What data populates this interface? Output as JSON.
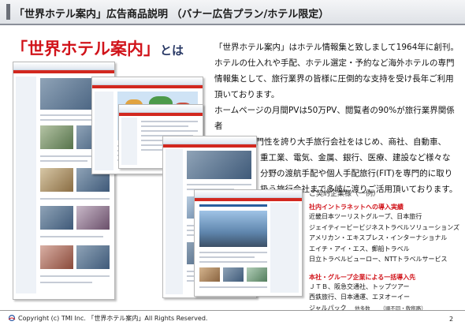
{
  "header": {
    "title": "「世界ホテル案内」広告商品説明 （バナー広告プラン/ホテル限定）"
  },
  "headline": {
    "main": "「世界ホテル案内」",
    "suffix": "とは"
  },
  "intro": {
    "p1": "「世界ホテル案内」はホテル情報集と致しまして1964年に創刊。",
    "p2": "ホテルの仕入れや手配、ホテル選定・予約など海外ホテルの専門",
    "p3": "情報集として、旅行業界の皆様に圧倒的な支持を受け長年ご利用",
    "p4": "頂いております。",
    "p5": "ホームページの月間PVは50万PV、閲覧者の90%が旅行業界関係者",
    "p6": "を占める専門性を誇り大手旅行会社をはじめ、商社、自動車、",
    "p7": "重工業、電気、金属、銀行、医療、建設など様々な",
    "p8": "分野の渡航手配や個人手配旅行(FIT)を専門的に取り",
    "p9": "扱う旅行会社まで多岐に渡りご活用頂いております。"
  },
  "clients": {
    "heading": "ご契約企業様（一例）",
    "intranet_heading": "社内イントラネットへの導入実績",
    "intranet_items": [
      "近畿日本ツーリストグループ、日本旅行",
      "ジェイティービービジネストラベルソリューションズ",
      "アメリカン・エキスプレス・インターナショナル",
      "エイチ・アイ・エス、郵船トラベル",
      "日立トラベルビューロー、NTTトラベルサービス"
    ],
    "bulk_heading": "本社・グループ企業による一括導入先",
    "bulk_items": [
      "ＪＴＢ、阪急交通社、トップツアー",
      "西鉄旅行、日本通運、エヌオーイー"
    ],
    "last_item": "ジャルパック",
    "last_note1": "他多数",
    "last_note2": "（順不同・敬称略）"
  },
  "footer": {
    "copyright": "Copyright (c) TMI Inc. 「世界ホテル案内」All Rights Reserved.",
    "page": "2"
  },
  "colors": {
    "accent_red": "#d1141b",
    "header_gray": "#dfe2e7"
  }
}
